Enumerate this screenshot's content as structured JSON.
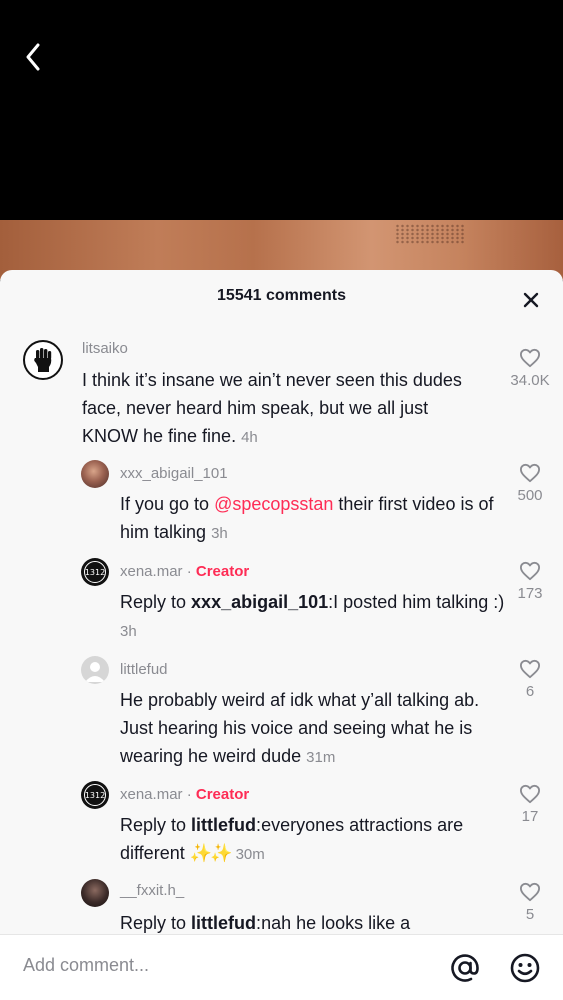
{
  "sheet": {
    "title": "15541 comments"
  },
  "comments": [
    {
      "username": "litsaiko",
      "text": "I think it’s insane we ain’t never seen this dudes face, never heard him speak, but we all just KNOW he fine fine.",
      "time": "4h",
      "likes": "34.0K"
    },
    {
      "username": "xxx_abigail_101",
      "text_before": "If you go to ",
      "mention": "@specopsstan",
      "text_after": " their first video is of him talking",
      "time": "3h",
      "likes": "500"
    },
    {
      "username": "xena.mar",
      "separator": " · ",
      "badge": "Creator",
      "reply_prefix": "Reply to ",
      "reply_to": "xxx_abigail_101",
      "reply_sep": ":",
      "text": "I posted him talking :)",
      "time": "3h",
      "likes": "173"
    },
    {
      "username": "littlefud",
      "text": "He probably weird af idk what y’all talking ab. Just hearing his voice and seeing what he is wearing he weird dude",
      "time": "31m",
      "likes": "6"
    },
    {
      "username": "xena.mar",
      "separator": " · ",
      "badge": "Creator",
      "reply_prefix": "Reply to ",
      "reply_to": "littlefud",
      "reply_sep": ":",
      "text": "everyones attractions are different ",
      "sparkles": "✨✨",
      "time": "30m",
      "likes": "17"
    },
    {
      "username": "__fxxit.h_",
      "reply_prefix": "Reply to ",
      "reply_to": "littlefud",
      "reply_sep": ":",
      "text": "nah he looks like a",
      "likes": "5"
    }
  ],
  "avatars": {
    "creator_badge_text": "1312"
  },
  "input": {
    "placeholder": "Add comment..."
  },
  "icons": {
    "back": "chevron-left-icon",
    "close": "close-icon",
    "like": "heart-outline-icon",
    "mention": "at-sign-icon",
    "emoji": "smiley-icon"
  },
  "colors": {
    "accent": "#fe2c55",
    "muted": "#8a8b91",
    "sheet": "#f8f8f8"
  }
}
